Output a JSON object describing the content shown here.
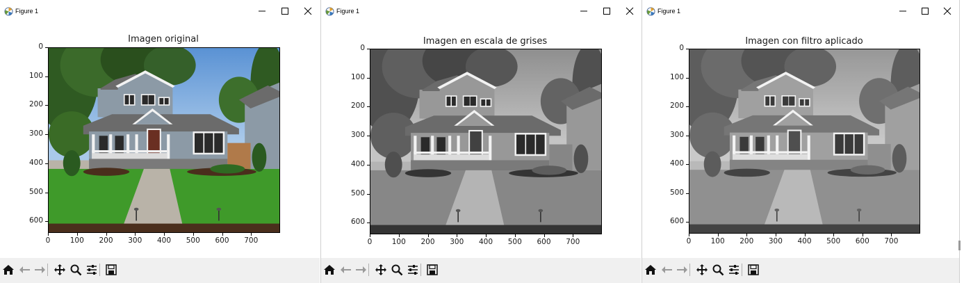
{
  "windows": [
    {
      "title": "Figure 1",
      "plot_title": "Imagen original",
      "mode": "color"
    },
    {
      "title": "Figure 1",
      "plot_title": "Imagen en escala de grises",
      "mode": "gray"
    },
    {
      "title": "Figure 1",
      "plot_title": "Imagen con filtro aplicado",
      "mode": "gray"
    }
  ],
  "axes": {
    "x_ticks": [
      "0",
      "100",
      "200",
      "300",
      "400",
      "500",
      "600",
      "700"
    ],
    "y_ticks": [
      "0",
      "100",
      "200",
      "300",
      "400",
      "500",
      "600"
    ]
  },
  "toolbar": {
    "icons": [
      "home-icon",
      "back-arrow-icon",
      "forward-arrow-icon",
      "pan-icon",
      "zoom-icon",
      "subplots-config-icon",
      "save-icon"
    ]
  },
  "colors": {
    "sky": "#6fa6dc",
    "grass": "#3f9a2a",
    "house_siding": "#8c9aa6",
    "trim": "#f2f2f2",
    "roof": "#6b6b6b",
    "door": "#6a2f22",
    "path": "#b9b3a8",
    "trees": "#2f5a22",
    "toolbar_bg": "#f0f0f0"
  }
}
